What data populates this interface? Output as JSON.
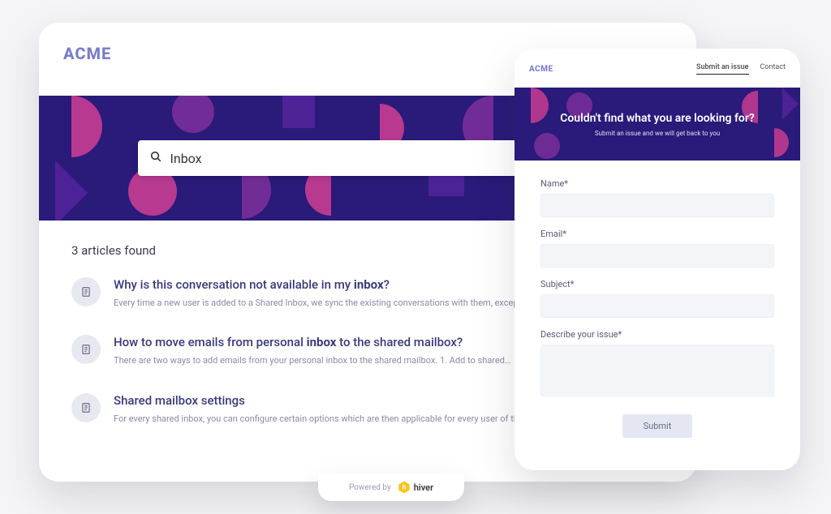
{
  "brand": "ACME",
  "search": {
    "value": "Inbox"
  },
  "results_count_text": "3 articles found",
  "results": [
    {
      "title_html": "Why is this conversation not available in my <b>inbox</b>?",
      "snippet": "Every time a new user is added to a Shared Inbox, we sync the existing conversations with them, except…"
    },
    {
      "title_html": "How to move emails from personal <b>inbox</b> to the shared mailbox?",
      "snippet": "There are two ways to add emails from your personal inbox to the shared mailbox. 1. Add to shared…"
    },
    {
      "title_html": "Shared mailbox settings",
      "snippet": "For every shared inbox, you can configure certain options which are then applicable for every user of th …"
    }
  ],
  "form": {
    "nav": {
      "submit": "Submit an issue",
      "contact": "Contact"
    },
    "hero_title": "Couldn't find what you are looking for?",
    "hero_sub": "Submit an issue and we will get back to you",
    "labels": {
      "name": "Name*",
      "email": "Email*",
      "subject": "Subject*",
      "describe": "Describe your issue*"
    },
    "submit_label": "Submit"
  },
  "powered_by": {
    "prefix": "Powered by",
    "product": "hiver"
  }
}
